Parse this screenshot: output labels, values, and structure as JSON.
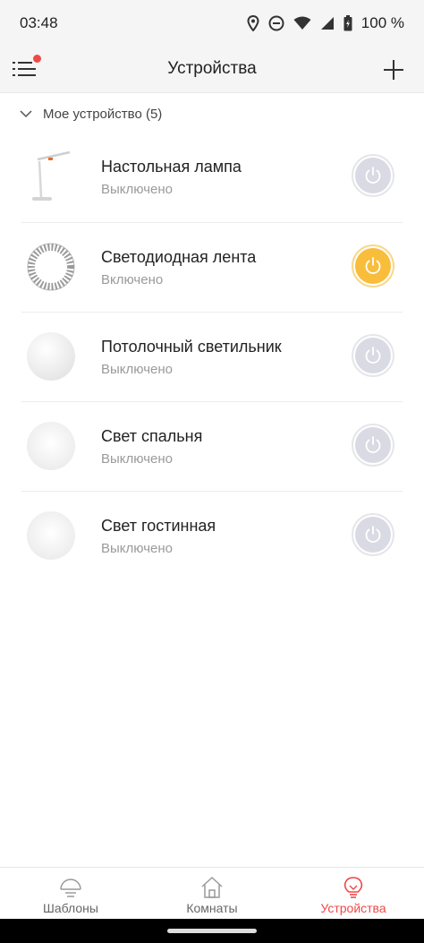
{
  "status": {
    "time": "03:48",
    "battery": "100 %",
    "icons": [
      "location-icon",
      "dnd-icon",
      "wifi-icon",
      "signal-icon",
      "battery-icon"
    ]
  },
  "appbar": {
    "title": "Устройства",
    "menu_icon": "menu-icon",
    "add_icon": "plus-icon"
  },
  "section": {
    "label": "Мое устройство (5)"
  },
  "devices": [
    {
      "name": "Настольная лампа",
      "state": "Выключено",
      "icon": "desk-lamp",
      "on": false
    },
    {
      "name": "Светодиодная лента",
      "state": "Включено",
      "icon": "led-strip",
      "on": true
    },
    {
      "name": "Потолочный светильник",
      "state": "Выключено",
      "icon": "ceiling-light",
      "on": false
    },
    {
      "name": "Свет спальня",
      "state": "Выключено",
      "icon": "round-light",
      "on": false
    },
    {
      "name": "Свет гостинная",
      "state": "Выключено",
      "icon": "round-light",
      "on": false
    }
  ],
  "nav": {
    "tabs": [
      {
        "label": "Шаблоны",
        "icon": "lightbulb-outline-icon",
        "active": false
      },
      {
        "label": "Комнаты",
        "icon": "home-icon",
        "active": false
      },
      {
        "label": "Устройства",
        "icon": "bulb-icon",
        "active": true
      }
    ]
  },
  "colors": {
    "accent": "#f04848",
    "power_on": "#f9bd3c",
    "power_off": "#d9dae3"
  }
}
